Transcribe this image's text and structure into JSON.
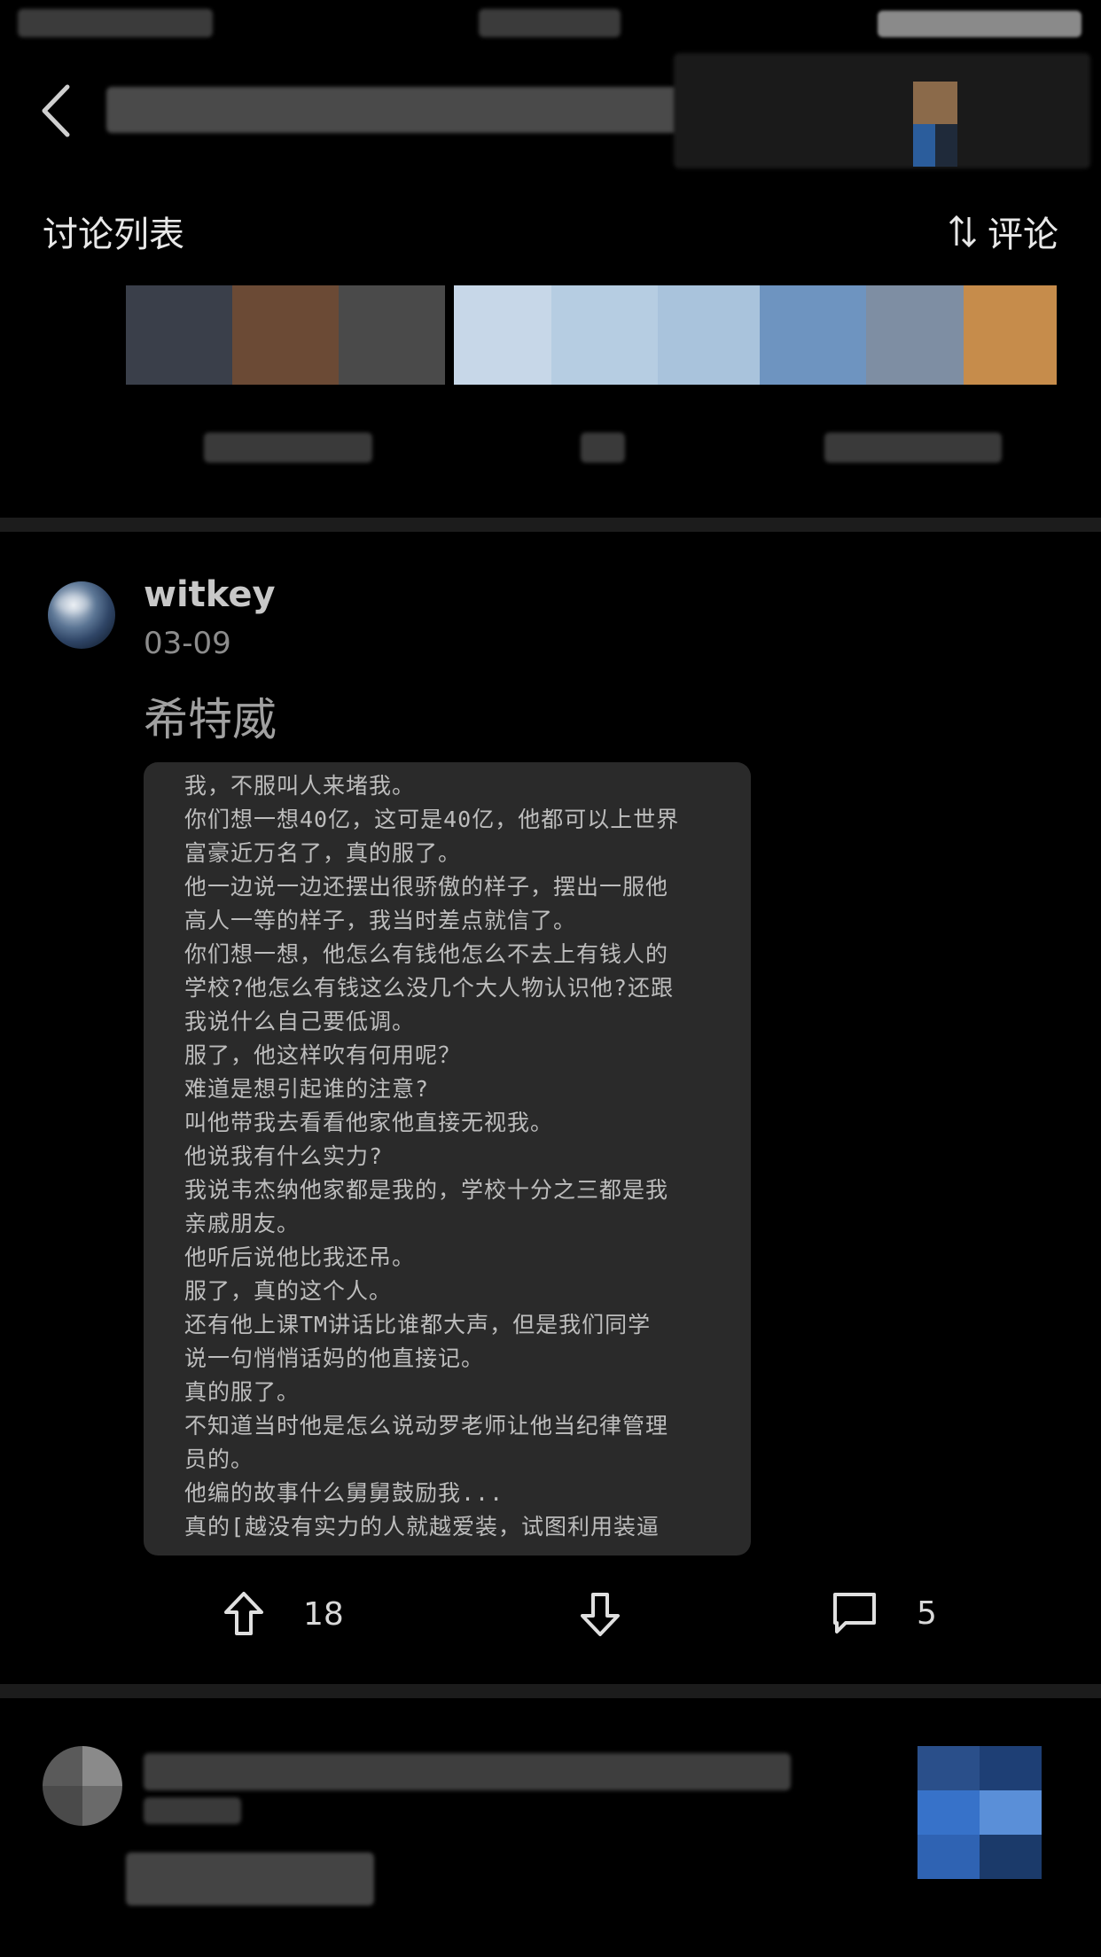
{
  "header": {
    "section_title": "讨论列表",
    "sort_label": "评论"
  },
  "post": {
    "username": "witkey",
    "date": "03-09",
    "title": "希特威",
    "note_lines": [
      "我，不服叫人来堵我。",
      "你们想一想40亿，这可是40亿，他都可以上世界",
      "富豪近万名了，真的服了。",
      "他一边说一边还摆出很骄傲的样子，摆出一服他",
      "高人一等的样子，我当时差点就信了。",
      "你们想一想，他怎么有钱他怎么不去上有钱人的",
      "学校?他怎么有钱这么没几个大人物认识他?还跟",
      "我说什么自己要低调。",
      "服了，他这样吹有何用呢？",
      "难道是想引起谁的注意?",
      "叫他带我去看看他家他直接无视我。",
      "他说我有什么实力?",
      "我说韦杰纳他家都是我的，学校十分之三都是我",
      "亲戚朋友。",
      "他听后说他比我还吊。",
      "服了，真的这个人。",
      "还有他上课TM讲话比谁都大声，但是我们同学",
      "说一句悄悄话妈的他直接记。",
      "真的服了。",
      "不知道当时他是怎么说动罗老师让他当纪律管理",
      "员的。",
      "他编的故事什么舅舅鼓励我...",
      "真的[越没有实力的人就越爱装，试图利用装逼"
    ],
    "upvotes": "18",
    "comments": "5"
  }
}
